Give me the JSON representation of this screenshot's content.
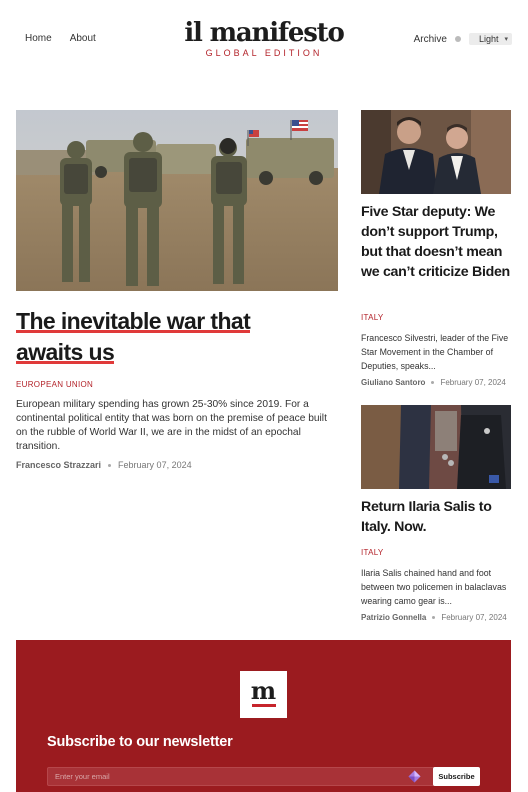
{
  "nav": {
    "home": "Home",
    "about": "About",
    "archive": "Archive",
    "theme_value": "Light"
  },
  "logo": {
    "title": "il manifesto",
    "subtitle": "GLOBAL EDITION"
  },
  "main_article": {
    "title": "The inevitable war that awaits us",
    "tag": "EUROPEAN UNION",
    "excerpt": "European military spending has grown 25-30% since 2019. For a continental political entity that was born on the premise of peace built on the rubble of World War II, we are in the midst of an epochal transition.",
    "author": "Francesco Strazzari",
    "date": "February 07, 2024"
  },
  "side_articles": [
    {
      "title": "Five Star deputy: We don’t support Trump, but that doesn’t mean we can’t criticize Biden",
      "tag": "ITALY",
      "excerpt": "Francesco Silvestri, leader of the Five Star Movement in the Chamber of Deputies, speaks...",
      "author": "Giuliano Santoro",
      "date": "February 07, 2024"
    },
    {
      "title": "Return Ilaria Salis to Italy. Now.",
      "tag": "ITALY",
      "excerpt": "Ilaria Salis chained hand and foot between two policemen in balaclavas wearing camo gear is...",
      "author": "Patrizio Gonnella",
      "date": "February 07, 2024"
    }
  ],
  "newsletter": {
    "logo_letter": "m",
    "title": "Subscribe to our newsletter",
    "placeholder": "Enter your email",
    "button": "Subscribe"
  },
  "colors": {
    "accent": "#b3232a",
    "newsletter_bg": "#9b1b1f",
    "underline": "#e03a3a"
  }
}
